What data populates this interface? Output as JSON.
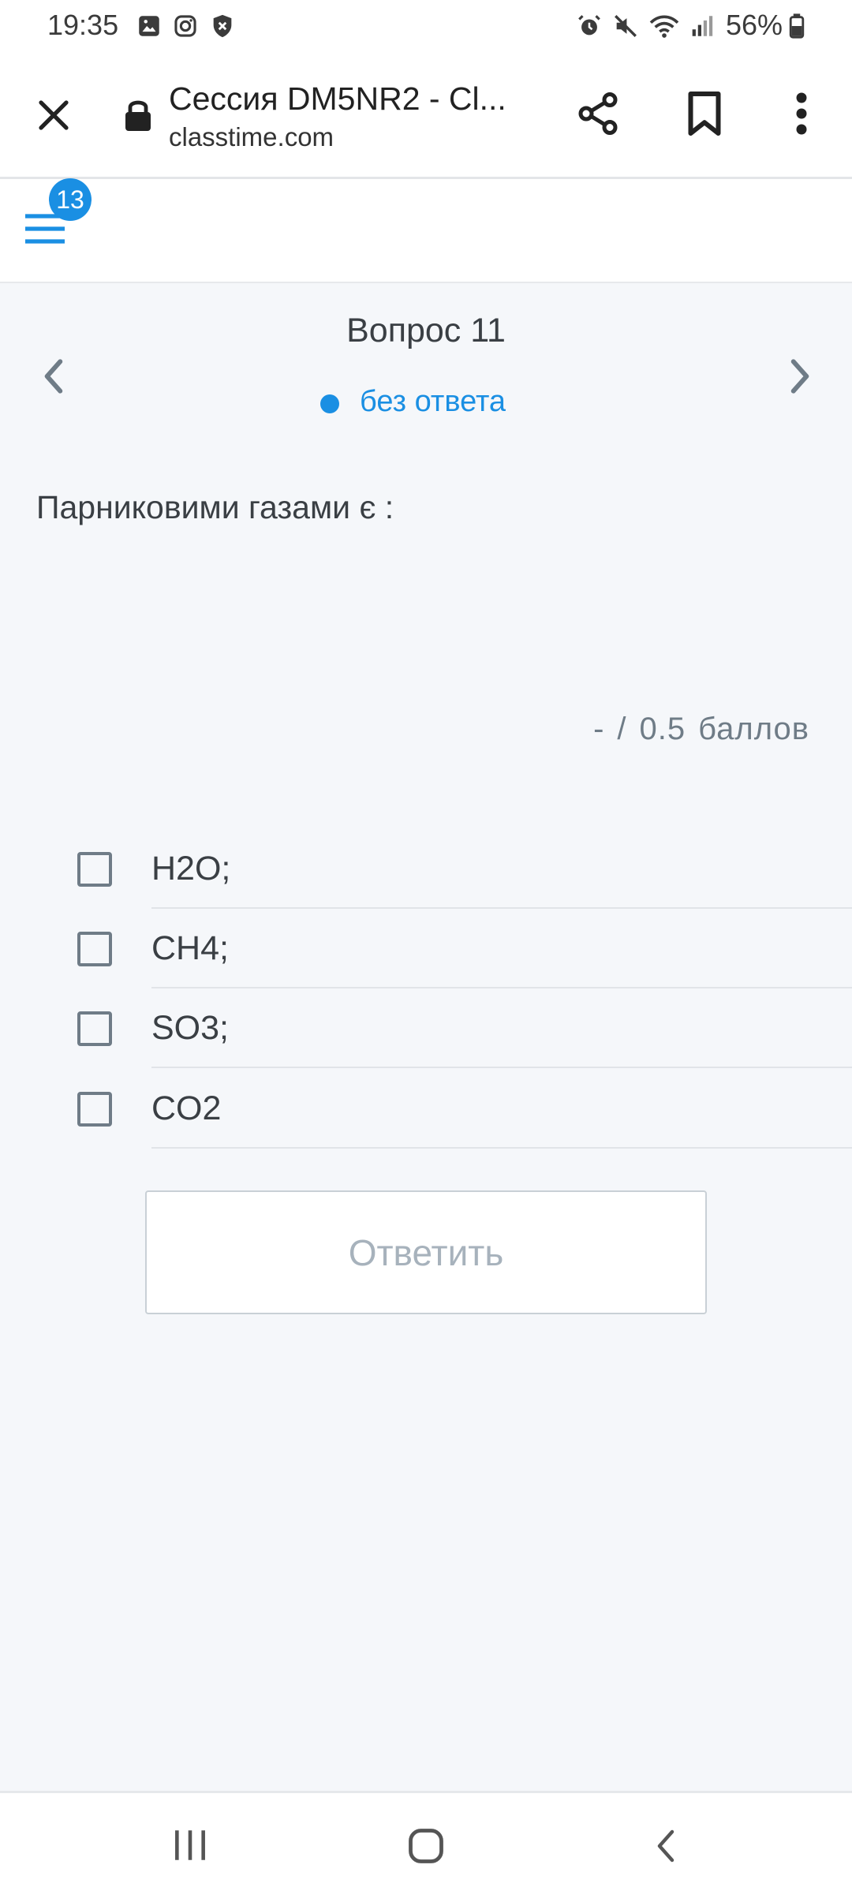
{
  "status_bar": {
    "time": "19:35",
    "battery": "56%",
    "icons": [
      "gallery-icon",
      "instagram-icon",
      "vpn-shield-icon",
      "alarm-icon",
      "mute-icon",
      "wifi-icon",
      "signal-icon",
      "battery-icon"
    ]
  },
  "browser": {
    "title": "Сессия DM5NR2 - Cl...",
    "url": "classtime.com",
    "icons": [
      "close-icon",
      "lock-icon",
      "share-icon",
      "bookmark-icon",
      "more-vert-icon"
    ]
  },
  "app_header": {
    "menu_badge": "13"
  },
  "question": {
    "title": "Вопрос 11",
    "status": "без ответа",
    "text": "Парниковими газами є :",
    "score": {
      "earned": "-",
      "separator": "/",
      "max": "0.5",
      "unit": "баллов"
    },
    "options": [
      {
        "label": "H2O;",
        "checked": false
      },
      {
        "label": "CH4;",
        "checked": false
      },
      {
        "label": "SO3;",
        "checked": false
      },
      {
        "label": "CO2",
        "checked": false
      }
    ],
    "answer_button": "Ответить"
  },
  "colors": {
    "accent": "#1a8fe3",
    "text": "#3a3f44",
    "muted": "#6f7c87",
    "background": "#f5f7fa"
  }
}
